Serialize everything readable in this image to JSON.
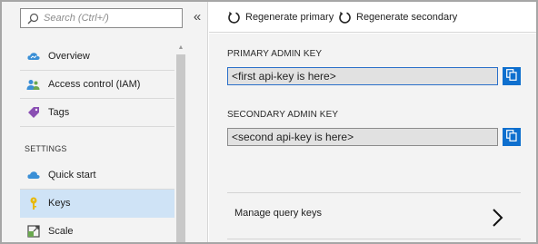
{
  "search": {
    "placeholder": "Search (Ctrl+/)"
  },
  "collapse": {
    "glyph": "«"
  },
  "nav": {
    "items": [
      {
        "label": "Overview",
        "icon": "cloud-icon"
      },
      {
        "label": "Access control (IAM)",
        "icon": "people-icon"
      },
      {
        "label": "Tags",
        "icon": "tag-icon"
      }
    ],
    "section_title": "SETTINGS",
    "settings_items": [
      {
        "label": "Quick start",
        "icon": "quickstart-cloud-icon"
      },
      {
        "label": "Keys",
        "icon": "key-icon",
        "active": true
      },
      {
        "label": "Scale",
        "icon": "scale-icon"
      }
    ]
  },
  "toolbar": {
    "regen_primary": "Regenerate primary",
    "regen_secondary": "Regenerate secondary"
  },
  "keys": {
    "primary_label": "PRIMARY ADMIN KEY",
    "primary_value": "<first api-key is here>",
    "secondary_label": "SECONDARY ADMIN KEY",
    "secondary_value": "<second api-key is here>"
  },
  "manage": {
    "label": "Manage query keys"
  },
  "colors": {
    "accent": "#0e6fce",
    "active_bg": "#cfe3f6",
    "pane_bg": "#f3f3f3"
  }
}
